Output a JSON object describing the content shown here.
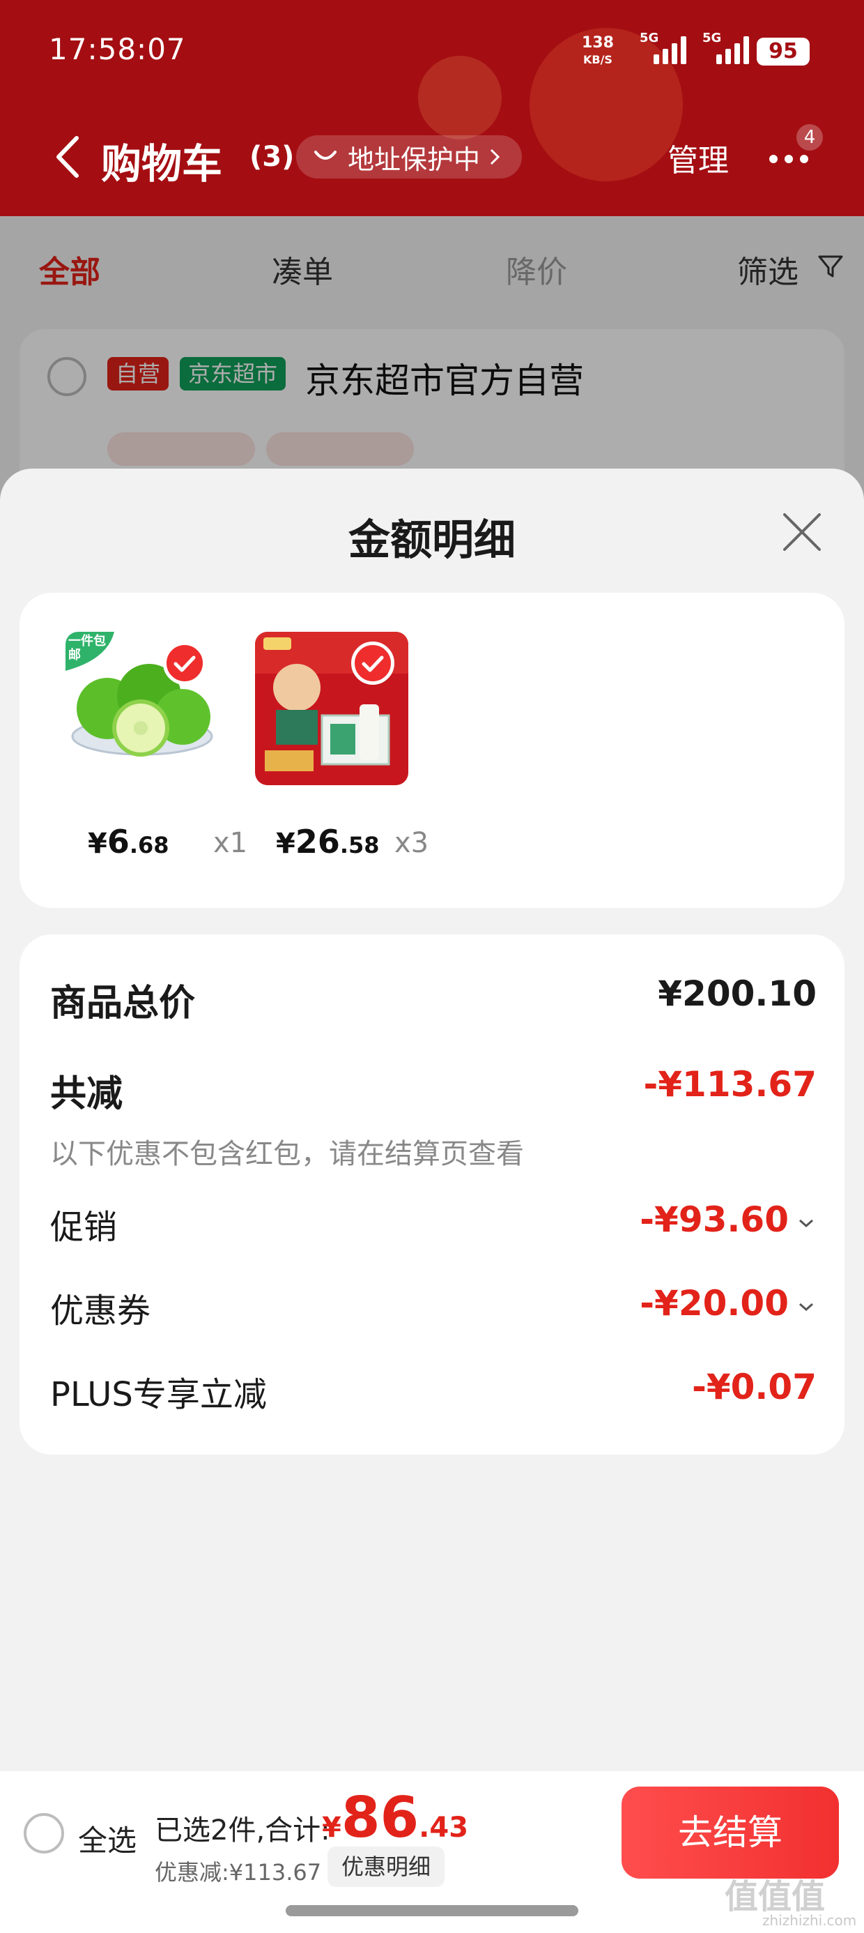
{
  "status": {
    "time": "17:58:07",
    "net_speed": "138",
    "net_unit": "KB/S",
    "sig1": "5G",
    "sig2": "5G",
    "battery": "95"
  },
  "header": {
    "title": "购物车",
    "count": "(3)",
    "address_protect": "地址保护中",
    "manage": "管理",
    "more_badge": "4"
  },
  "tabs": [
    {
      "label": "全部"
    },
    {
      "label": "凑单"
    },
    {
      "label": "降价"
    },
    {
      "label": "筛选"
    }
  ],
  "store": {
    "tag_self": "自营",
    "tag_market": "京东超市",
    "name": "京东超市官方自营"
  },
  "sheet": {
    "title": "金额明细",
    "items": [
      {
        "cur": "¥",
        "int": "6",
        "dec": ".68",
        "qty": "x1",
        "badge": "一件包邮"
      },
      {
        "cur": "¥",
        "int": "26",
        "dec": ".58",
        "qty": "x3"
      }
    ],
    "summary": {
      "total_label": "商品总价",
      "total_value": "¥200.10",
      "discount_label": "共减",
      "discount_value": "-¥113.67",
      "note": "以下优惠不包含红包，请在结算页查看",
      "promo_label": "促销",
      "promo_value": "-¥93.60",
      "coupon_label": "优惠券",
      "coupon_value": "-¥20.00",
      "plus_label": "PLUS专享立减",
      "plus_value": "-¥0.07"
    }
  },
  "bottom": {
    "select_all": "全选",
    "selected": "已选2件,合计:",
    "total_cur": "¥",
    "total_int": "86",
    "total_dec": ".43",
    "saved": "优惠减:¥113.67",
    "detail": "优惠明细",
    "checkout": "去结算"
  },
  "watermark": {
    "main": "值值值",
    "sub": "zhizhizhi.com"
  },
  "colors": {
    "header": "#a40e12",
    "accent_red": "#e2231a",
    "checkout": "#f23030"
  }
}
